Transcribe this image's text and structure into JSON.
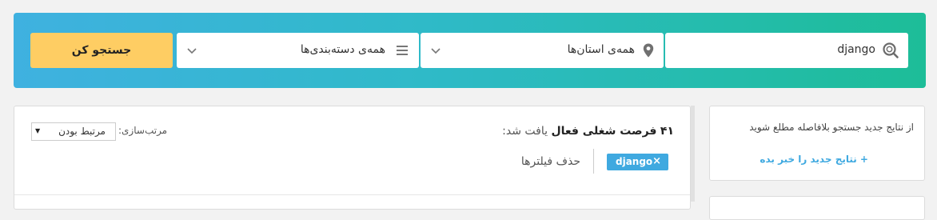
{
  "search": {
    "keyword": "django",
    "province": "همه‌ی استان‌ها",
    "category": "همه‌ی دسته‌بندی‌ها",
    "button_label": "جستجو کن"
  },
  "results": {
    "count": "۴۱",
    "count_label": "فرصت شغلی فعال",
    "found_suffix": "یافت شد:",
    "clear_filters": "حذف فیلترها",
    "tag": "django",
    "tag_remove": "×",
    "sort_label": "مرتب‌سازی:",
    "sort_value": "مرتبط بودن",
    "sort_arrow": "▼"
  },
  "notify": {
    "text": "از نتایج جدید جستجو بلافاصله مطلع شوید",
    "link": "+ نتایج جدید را خبر بده"
  },
  "colors": {
    "gradient_start": "#3fb1e0",
    "gradient_end": "#1dbd98",
    "accent_button": "#fecd63",
    "tag": "#3fa9e0",
    "link": "#3fa9e0"
  }
}
